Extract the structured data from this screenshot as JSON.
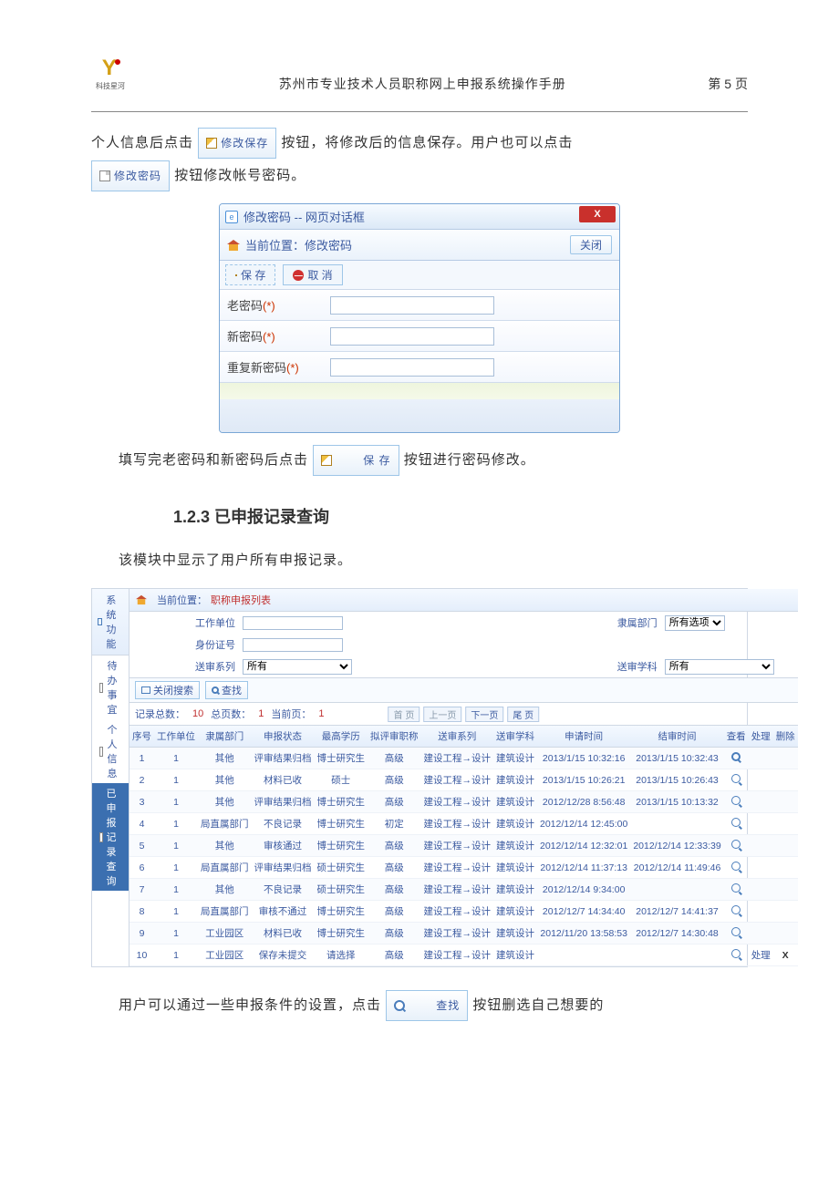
{
  "header": {
    "logo_caption": "科技星河",
    "title": "苏州市专业技术人员职称网上申报系统操作手册",
    "page_label": "第 5 页"
  },
  "para1_a": "个人信息后点击",
  "btn_edit_save": "修改保存",
  "para1_b": "按钮，将修改后的信息保存。用户也可以点击",
  "btn_change_pwd": "修改密码",
  "para1_c": "按钮修改帐号密码。",
  "dialog": {
    "window_title": "修改密码 -- 网页对话框",
    "location_prefix": "当前位置：",
    "location_value": "修改密码",
    "close_btn": "关闭",
    "save_btn": "保 存",
    "cancel_btn": "取 消",
    "close_x": "X",
    "fields": {
      "old_pwd": "老密码",
      "new_pwd": "新密码",
      "repeat_pwd": "重复新密码",
      "star": "(*)"
    }
  },
  "para2_a": "填写完老密码和新密码后点击",
  "btn_save_inline": "保 存",
  "para2_b": "按钮进行密码修改。",
  "section_heading": "1.2.3 已申报记录查询",
  "para3": "该模块中显示了用户所有申报记录。",
  "panel": {
    "side_header": "系统功能",
    "side_items": [
      "待办事宜",
      "个人信息",
      "已申报记录查询"
    ],
    "breadcrumb_prefix": "当前位置：",
    "breadcrumb_value": "职称申报列表",
    "filters": {
      "work_unit_label": "工作单位",
      "dept_label": "隶属部门",
      "dept_value": "所有选项",
      "id_label": "身份证号",
      "series_label": "送审系列",
      "series_value": "所有",
      "subject_label": "送审学科",
      "subject_value": "所有"
    },
    "toolbar": {
      "close_search": "关闭搜索",
      "find": "查找"
    },
    "stats": {
      "total_label": "记录总数：",
      "total_value": "10",
      "pages_label": "总页数：",
      "pages_value": "1",
      "current_label": "当前页：",
      "current_value": "1"
    },
    "pager": {
      "first": "首 页",
      "prev": "上一页",
      "next": "下一页",
      "last": "尾 页"
    },
    "columns": [
      "序号",
      "工作单位",
      "隶属部门",
      "申报状态",
      "最高学历",
      "拟评审职称",
      "送审系列",
      "送审学科",
      "申请时间",
      "结审时间",
      "查看",
      "处理",
      "删除"
    ],
    "rows": [
      {
        "n": "1",
        "wu": "1",
        "dept": "其他",
        "status": "评审结果归档",
        "edu": "博士研究生",
        "title": "高级",
        "series": "建设工程→设计",
        "subj": "建筑设计",
        "apply": "2013/1/15 10:32:16",
        "end": "2013/1/15 10:32:43",
        "view": "bold",
        "proc": "",
        "del": ""
      },
      {
        "n": "2",
        "wu": "1",
        "dept": "其他",
        "status": "材料已收",
        "edu": "硕士",
        "title": "高级",
        "series": "建设工程→设计",
        "subj": "建筑设计",
        "apply": "2013/1/15 10:26:21",
        "end": "2013/1/15 10:26:43",
        "view": "y",
        "proc": "",
        "del": ""
      },
      {
        "n": "3",
        "wu": "1",
        "dept": "其他",
        "status": "评审结果归档",
        "edu": "博士研究生",
        "title": "高级",
        "series": "建设工程→设计",
        "subj": "建筑设计",
        "apply": "2012/12/28 8:56:48",
        "end": "2013/1/15 10:13:32",
        "view": "y",
        "proc": "",
        "del": ""
      },
      {
        "n": "4",
        "wu": "1",
        "dept": "局直属部门",
        "status": "不良记录",
        "edu": "博士研究生",
        "title": "初定",
        "series": "建设工程→设计",
        "subj": "建筑设计",
        "apply": "2012/12/14 12:45:00",
        "end": "",
        "view": "y",
        "proc": "",
        "del": ""
      },
      {
        "n": "5",
        "wu": "1",
        "dept": "其他",
        "status": "审核通过",
        "edu": "博士研究生",
        "title": "高级",
        "series": "建设工程→设计",
        "subj": "建筑设计",
        "apply": "2012/12/14 12:32:01",
        "end": "2012/12/14 12:33:39",
        "view": "y",
        "proc": "",
        "del": ""
      },
      {
        "n": "6",
        "wu": "1",
        "dept": "局直属部门",
        "status": "评审结果归档",
        "edu": "硕士研究生",
        "title": "高级",
        "series": "建设工程→设计",
        "subj": "建筑设计",
        "apply": "2012/12/14 11:37:13",
        "end": "2012/12/14 11:49:46",
        "view": "y",
        "proc": "",
        "del": ""
      },
      {
        "n": "7",
        "wu": "1",
        "dept": "其他",
        "status": "不良记录",
        "edu": "硕士研究生",
        "title": "高级",
        "series": "建设工程→设计",
        "subj": "建筑设计",
        "apply": "2012/12/14 9:34:00",
        "end": "",
        "view": "y",
        "proc": "",
        "del": ""
      },
      {
        "n": "8",
        "wu": "1",
        "dept": "局直属部门",
        "status": "审核不通过",
        "edu": "博士研究生",
        "title": "高级",
        "series": "建设工程→设计",
        "subj": "建筑设计",
        "apply": "2012/12/7 14:34:40",
        "end": "2012/12/7 14:41:37",
        "view": "y",
        "proc": "",
        "del": ""
      },
      {
        "n": "9",
        "wu": "1",
        "dept": "工业园区",
        "status": "材料已收",
        "edu": "博士研究生",
        "title": "高级",
        "series": "建设工程→设计",
        "subj": "建筑设计",
        "apply": "2012/11/20 13:58:53",
        "end": "2012/12/7 14:30:48",
        "view": "y",
        "proc": "",
        "del": ""
      },
      {
        "n": "10",
        "wu": "1",
        "dept": "工业园区",
        "status": "保存未提交",
        "edu": "请选择",
        "title": "高级",
        "series": "建设工程→设计",
        "subj": "建筑设计",
        "apply": "",
        "end": "",
        "view": "y",
        "proc": "处理",
        "del": "X"
      }
    ]
  },
  "para4_a": "用户可以通过一些申报条件的设置，点击",
  "btn_find_inline": "查找",
  "para4_b": "按钮删选自己想要的"
}
